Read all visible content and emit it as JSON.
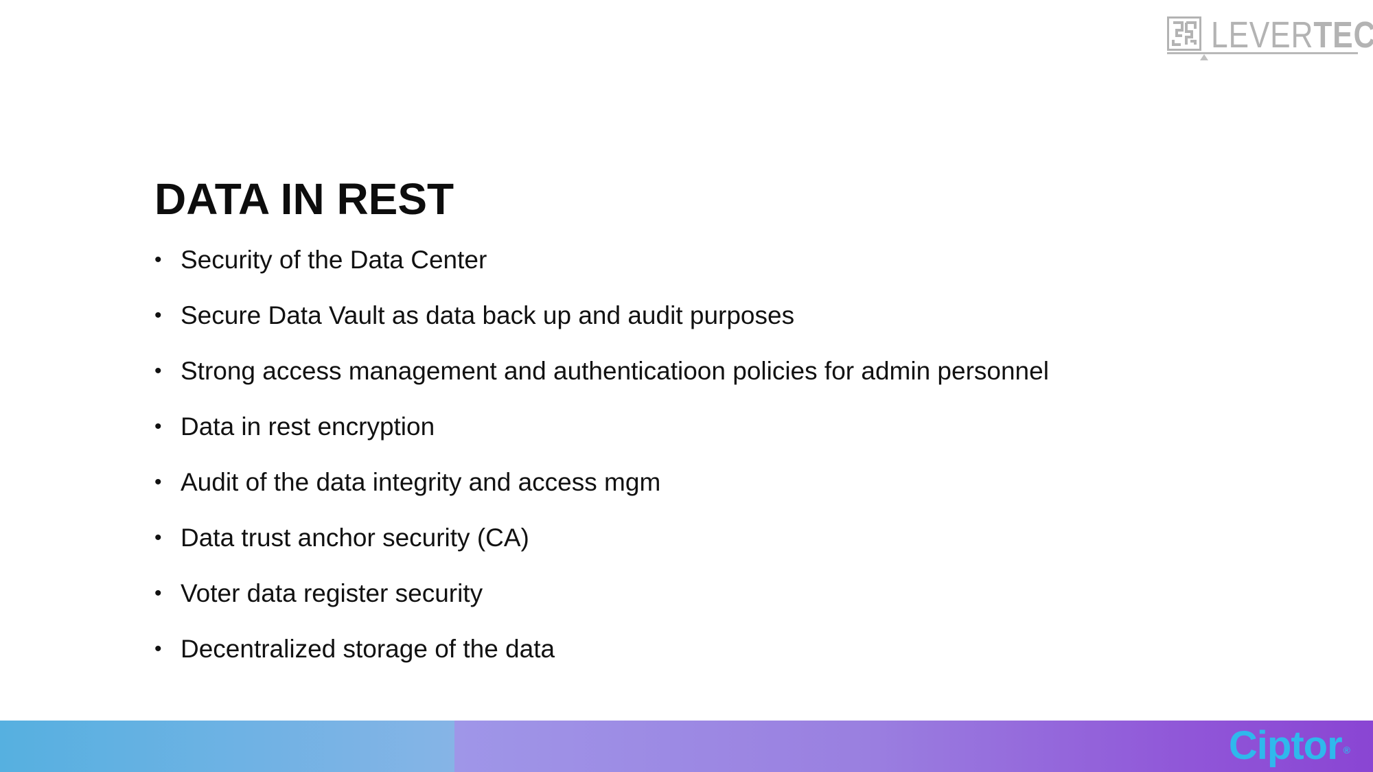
{
  "logo": {
    "text_light": "LEVER",
    "text_bold": "TECH",
    "icon": "maze-square-icon",
    "color": "#b3b3b3"
  },
  "slide": {
    "title": "DATA IN REST",
    "bullet_symbol": "•",
    "bullets": [
      "Security of the Data Center",
      "Secure Data Vault as data back up and audit purposes",
      "Strong access management and authenticatioon policies for admin personnel",
      "Data in rest encryption",
      "Audit of the data integrity and access mgm",
      "Data trust anchor security (CA)",
      "Voter data register security",
      "Decentralized storage of the data"
    ]
  },
  "footer": {
    "brand": "Ciptor",
    "brand_registered": "®",
    "brand_color": "#2fb8ec",
    "left_color": "#56b0e0",
    "right_color": "#8a45d3"
  }
}
